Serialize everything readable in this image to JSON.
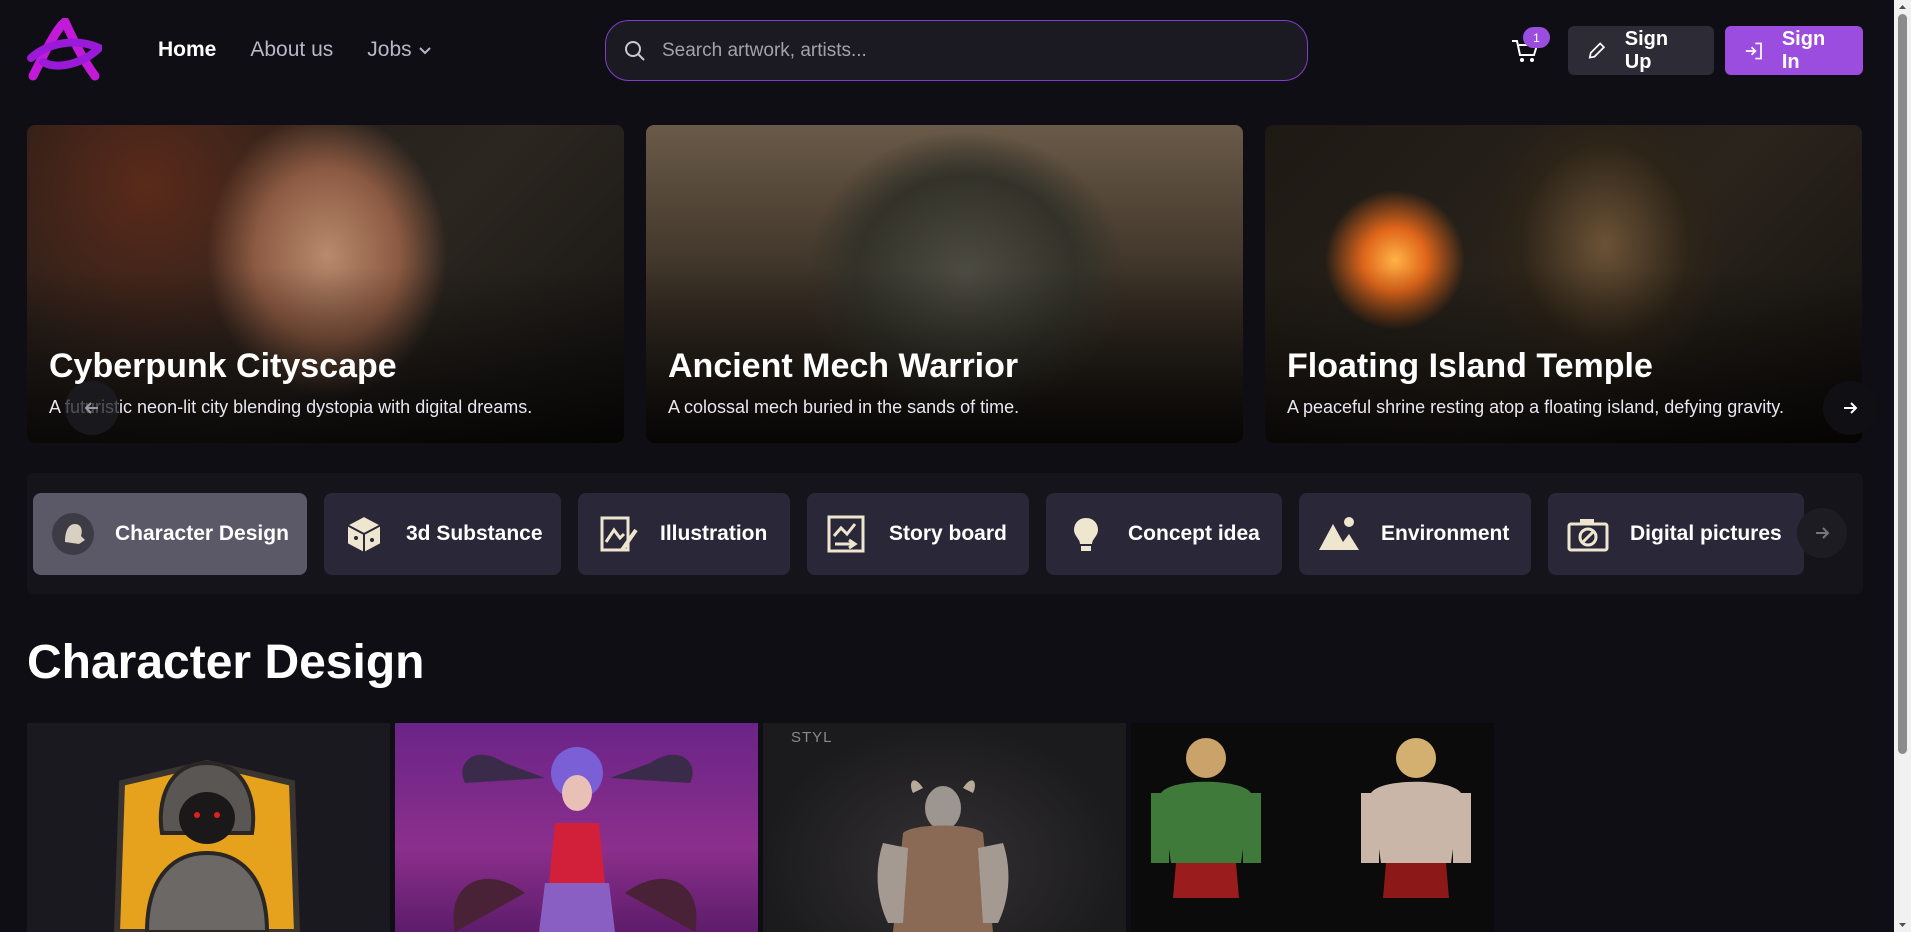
{
  "nav": {
    "items": [
      {
        "label": "Home",
        "active": true
      },
      {
        "label": "About us",
        "active": false
      },
      {
        "label": "Jobs",
        "active": false
      }
    ]
  },
  "search": {
    "placeholder": "Search artwork, artists..."
  },
  "cart": {
    "count": "1"
  },
  "auth": {
    "signup_label": "Sign Up",
    "signin_label": "Sign In"
  },
  "carousel": {
    "slides": [
      {
        "title": "Cyberpunk Cityscape",
        "description": "A futuristic neon-lit city blending dystopia with digital dreams."
      },
      {
        "title": "Ancient Mech Warrior",
        "description": "A colossal mech buried in the sands of time."
      },
      {
        "title": "Floating Island Temple",
        "description": "A peaceful shrine resting atop a floating island, defying gravity."
      }
    ]
  },
  "categories": [
    {
      "label": "Character Design",
      "icon": "character-icon",
      "active": true
    },
    {
      "label": "3d Substance",
      "icon": "cube-icon",
      "active": false
    },
    {
      "label": "Illustration",
      "icon": "illustration-icon",
      "active": false
    },
    {
      "label": "Story board",
      "icon": "storyboard-icon",
      "active": false
    },
    {
      "label": "Concept idea",
      "icon": "lightbulb-icon",
      "active": false
    },
    {
      "label": "Environment",
      "icon": "mountain-icon",
      "active": false
    },
    {
      "label": "Digital pictures",
      "icon": "camera-icon",
      "active": false
    }
  ],
  "section": {
    "title": "Character Design"
  },
  "gallery": {
    "watermark": "STYL"
  },
  "colors": {
    "background": "#0f0e14",
    "accent": "#9b4de0",
    "card": "#2a2838"
  }
}
